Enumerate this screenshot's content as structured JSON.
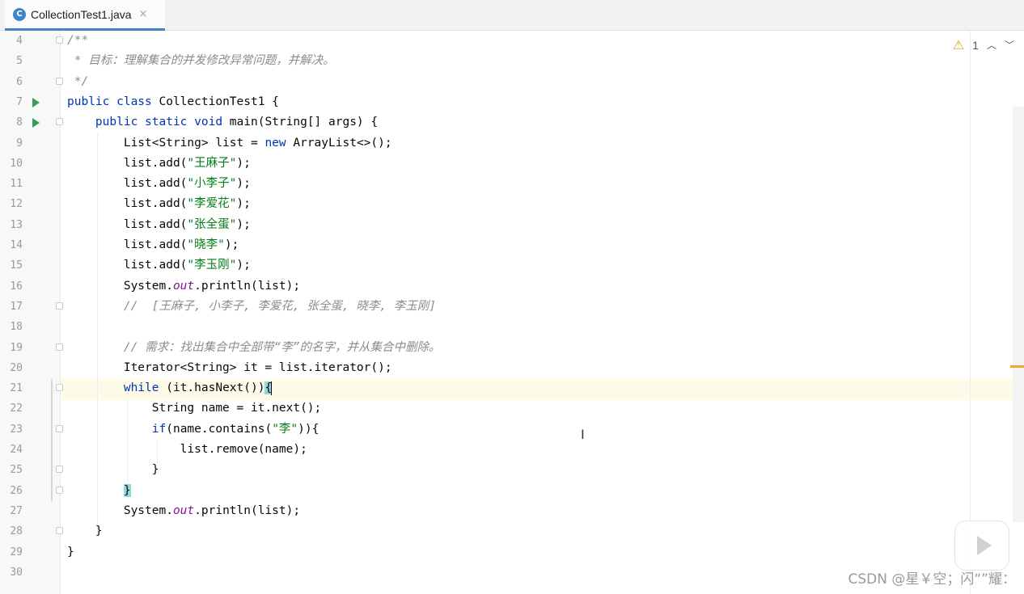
{
  "tab": {
    "icon": "C",
    "label": "CollectionTest1.java",
    "close": "×"
  },
  "inspections": {
    "warn_icon": "warning-icon",
    "warn_count": "1"
  },
  "lines": [
    {
      "n": "4",
      "run": false,
      "fold": true,
      "html": "<span class=\"cm\">/**</span>"
    },
    {
      "n": "5",
      "run": false,
      "fold": false,
      "html": "<span class=\"cm\"> * 目标：理解集合的并发修改异常问题，并解决。</span>"
    },
    {
      "n": "6",
      "run": false,
      "fold": true,
      "html": "<span class=\"cm\"> */</span>"
    },
    {
      "n": "7",
      "run": true,
      "fold": false,
      "html": "<span class=\"kw\">public class</span> CollectionTest1 {"
    },
    {
      "n": "8",
      "run": true,
      "fold": true,
      "html": "    <span class=\"kw\">public static void</span> main(String[] args) {"
    },
    {
      "n": "9",
      "run": false,
      "fold": false,
      "html": "        List&lt;String&gt; list = <span class=\"kw\">new</span> ArrayList&lt;&gt;();"
    },
    {
      "n": "10",
      "run": false,
      "fold": false,
      "html": "        list.add(<span class=\"st\">\"王麻子\"</span>);"
    },
    {
      "n": "11",
      "run": false,
      "fold": false,
      "html": "        list.add(<span class=\"st\">\"小李子\"</span>);"
    },
    {
      "n": "12",
      "run": false,
      "fold": false,
      "html": "        list.add(<span class=\"st\">\"李爱花\"</span>);"
    },
    {
      "n": "13",
      "run": false,
      "fold": false,
      "html": "        list.add(<span class=\"st\">\"张全蛋\"</span>);"
    },
    {
      "n": "14",
      "run": false,
      "fold": false,
      "html": "        list.add(<span class=\"st\">\"晓李\"</span>);"
    },
    {
      "n": "15",
      "run": false,
      "fold": false,
      "html": "        list.add(<span class=\"st\">\"李玉刚\"</span>);"
    },
    {
      "n": "16",
      "run": false,
      "fold": false,
      "html": "        System.<span class=\"fld\">out</span>.println(list);"
    },
    {
      "n": "17",
      "run": false,
      "fold": true,
      "html": "        <span class=\"cm\">//  [王麻子, 小李子, 李爱花, 张全蛋, 晓李, 李玉刚]</span>"
    },
    {
      "n": "18",
      "run": false,
      "fold": false,
      "html": ""
    },
    {
      "n": "19",
      "run": false,
      "fold": true,
      "html": "        <span class=\"cm\">// 需求：找出集合中全部带“李”的名字，并从集合中删除。</span>"
    },
    {
      "n": "20",
      "run": false,
      "fold": false,
      "html": "        Iterator&lt;String&gt; it = list.iterator();"
    },
    {
      "n": "21",
      "run": false,
      "fold": true,
      "html": "        <span class=\"kw\">while</span> (it.hasNext())<span class=\"brace-hl\">{</span><span class=\"caret\"></span>"
    },
    {
      "n": "22",
      "run": false,
      "fold": false,
      "html": "            String name = it.next();"
    },
    {
      "n": "23",
      "run": false,
      "fold": true,
      "html": "            <span class=\"kw\">if</span>(name.contains(<span class=\"st\">\"李\"</span>)){"
    },
    {
      "n": "24",
      "run": false,
      "fold": false,
      "html": "                list.remove(name);"
    },
    {
      "n": "25",
      "run": false,
      "fold": true,
      "html": "            }"
    },
    {
      "n": "26",
      "run": false,
      "fold": true,
      "html": "        <span class=\"brace-hl\">}</span>"
    },
    {
      "n": "27",
      "run": false,
      "fold": false,
      "html": "        System.<span class=\"fld\">out</span>.println(list);"
    },
    {
      "n": "28",
      "run": false,
      "fold": true,
      "html": "    }"
    },
    {
      "n": "29",
      "run": false,
      "fold": false,
      "html": "}"
    },
    {
      "n": "30",
      "run": false,
      "fold": false,
      "html": ""
    }
  ],
  "watermark": "CSDN @星￥空；闪“”耀："
}
